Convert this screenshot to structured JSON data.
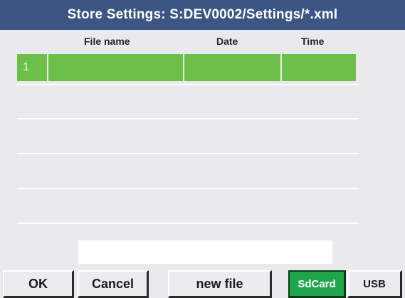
{
  "title": "Store Settings:  S:DEV0002/Settings/*.xml",
  "table": {
    "columns": [
      "File name",
      "Date",
      "Time"
    ],
    "rows": [
      {
        "index": "1",
        "file_name": "",
        "date": "",
        "time": "",
        "selected": true
      }
    ]
  },
  "filename_input": {
    "value": ""
  },
  "buttons": {
    "ok": "OK",
    "cancel": "Cancel",
    "new_file": "new file",
    "sdcard": "SdCard",
    "usb": "USB"
  },
  "colors": {
    "title_bar": "#3d5583",
    "selected_row": "#6cc04a",
    "sdcard_active": "#21a54b",
    "background": "#e9e9ee"
  }
}
